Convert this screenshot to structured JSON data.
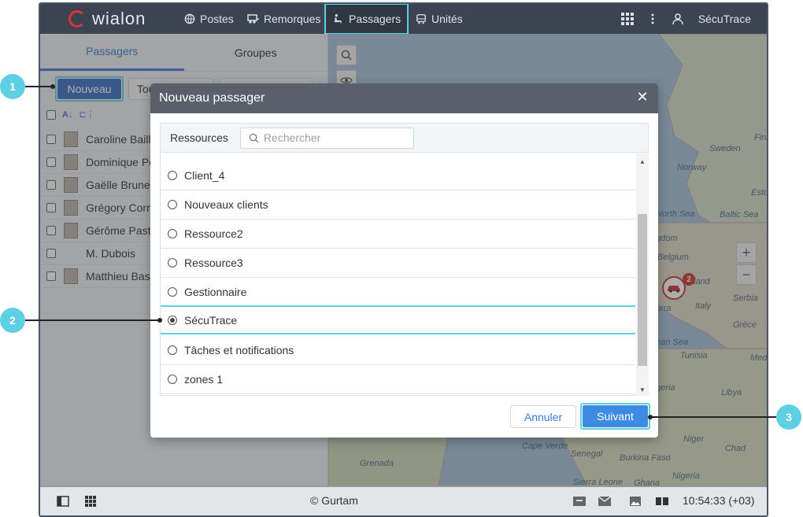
{
  "app": {
    "logo_text": "wialon",
    "nav": [
      {
        "label": "Postes"
      },
      {
        "label": "Remorques"
      },
      {
        "label": "Passagers"
      },
      {
        "label": "Unités"
      }
    ],
    "user": "SécuTrace"
  },
  "left_panel": {
    "tabs": [
      {
        "label": "Passagers"
      },
      {
        "label": "Groupes"
      }
    ],
    "nouveau_label": "Nouveau",
    "ghost_label": "Tou",
    "passengers": [
      {
        "name": "Caroline Bailla"
      },
      {
        "name": "Dominique Pe"
      },
      {
        "name": "Gaëlle Brunell"
      },
      {
        "name": "Grégory Corm"
      },
      {
        "name": "Gérôme Paste"
      },
      {
        "name": "M. Dubois"
      },
      {
        "name": "Matthieu Bass"
      }
    ]
  },
  "map": {
    "labels": [
      "Sweden",
      "Norway",
      "Finl",
      "Esto",
      "North Sea",
      "Baltic Sea",
      "gdom",
      "Belgium",
      "land",
      "Serbia",
      "Italy",
      "orra",
      "Grèce",
      "ean Sea",
      "Tunisia",
      "Medi",
      "geria",
      "Libya",
      "Niger",
      "Chad",
      "Cape Verde",
      "Senegal",
      "Burkina Faso",
      "Grenada",
      "Nigeria",
      "Sierra Leone",
      "Ghana"
    ],
    "cluster_count": "2",
    "zoom_in": "+",
    "zoom_out": "−"
  },
  "bottom": {
    "copyright": "© Gurtam",
    "time": "10:54:33 (+03)"
  },
  "dialog": {
    "title": "Nouveau passager",
    "resources_label": "Ressources",
    "search_placeholder": "Rechercher",
    "resources": [
      {
        "label": "Client_4",
        "selected": false
      },
      {
        "label": "Nouveaux clients",
        "selected": false
      },
      {
        "label": "Ressource2",
        "selected": false
      },
      {
        "label": "Ressource3",
        "selected": false
      },
      {
        "label": "Gestionnaire",
        "selected": false
      },
      {
        "label": "SécuTrace",
        "selected": true
      },
      {
        "label": "Tâches et notifications",
        "selected": false
      },
      {
        "label": "zones 1",
        "selected": false
      }
    ],
    "cancel_label": "Annuler",
    "next_label": "Suivant"
  },
  "callouts": [
    "1",
    "2",
    "3"
  ],
  "colors": {
    "accent": "#3a7bd5",
    "highlight": "#5fd0e3",
    "topbar": "#3b4450",
    "dialog_header": "#59606b"
  }
}
